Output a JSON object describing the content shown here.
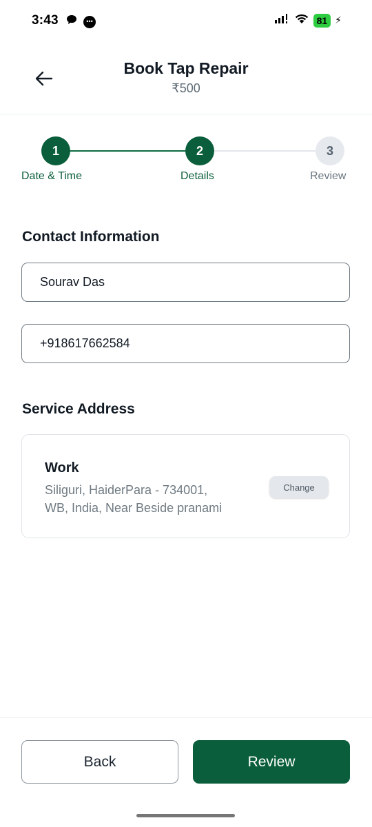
{
  "status_bar": {
    "time": "3:43",
    "battery": "81"
  },
  "header": {
    "title": "Book Tap Repair",
    "price": "₹500"
  },
  "stepper": {
    "steps": [
      {
        "number": "1",
        "label": "Date & Time",
        "state": "completed"
      },
      {
        "number": "2",
        "label": "Details",
        "state": "active"
      },
      {
        "number": "3",
        "label": "Review",
        "state": "pending"
      }
    ]
  },
  "contact": {
    "title": "Contact Information",
    "name": "Sourav Das",
    "phone": "+918617662584"
  },
  "address": {
    "title": "Service Address",
    "type": "Work",
    "line1": "Siliguri, HaiderPara - 734001,",
    "line2": "WB, India, Near Beside pranami",
    "change_label": "Change"
  },
  "footer": {
    "back_label": "Back",
    "review_label": "Review"
  },
  "colors": {
    "primary": "#0b5e3b",
    "inactive": "#e6e9ee",
    "battery": "#2ecc40"
  }
}
